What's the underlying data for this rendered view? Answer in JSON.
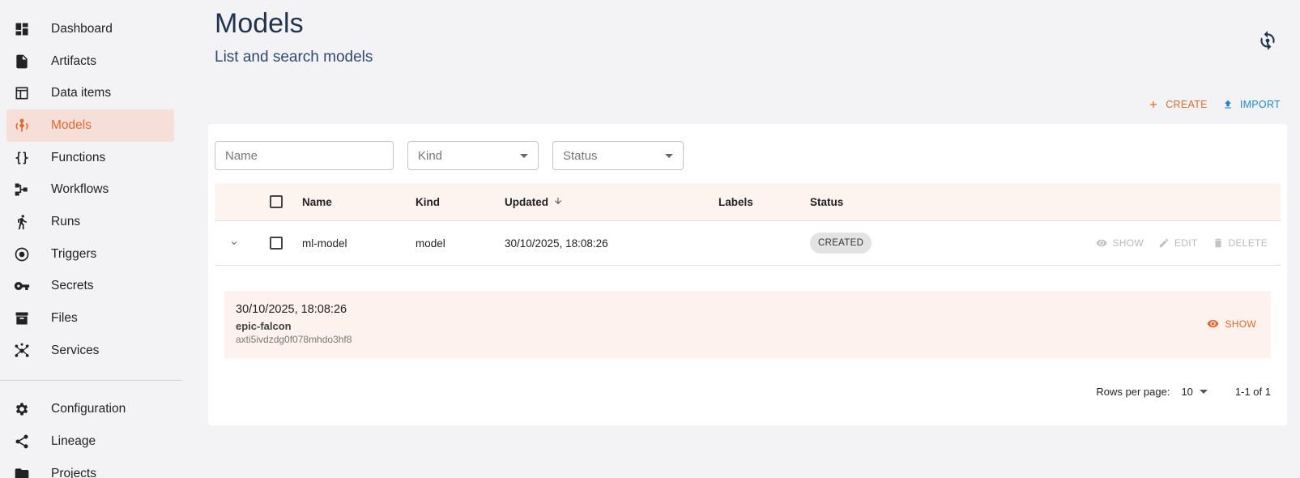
{
  "sidebar": {
    "items": [
      {
        "label": "Dashboard",
        "icon": "dashboard-icon",
        "active": false
      },
      {
        "label": "Artifacts",
        "icon": "file-icon",
        "active": false
      },
      {
        "label": "Data items",
        "icon": "table-icon",
        "active": false
      },
      {
        "label": "Models",
        "icon": "model-icon",
        "active": true
      },
      {
        "label": "Functions",
        "icon": "braces-icon",
        "active": false
      },
      {
        "label": "Workflows",
        "icon": "workflow-icon",
        "active": false
      },
      {
        "label": "Runs",
        "icon": "runner-icon",
        "active": false
      },
      {
        "label": "Triggers",
        "icon": "target-icon",
        "active": false
      },
      {
        "label": "Secrets",
        "icon": "key-icon",
        "active": false
      },
      {
        "label": "Files",
        "icon": "archive-icon",
        "active": false
      },
      {
        "label": "Services",
        "icon": "hub-icon",
        "active": false
      }
    ],
    "secondary_items": [
      {
        "label": "Configuration",
        "icon": "gear-icon"
      },
      {
        "label": "Lineage",
        "icon": "share-icon"
      },
      {
        "label": "Projects",
        "icon": "folder-icon"
      }
    ]
  },
  "header": {
    "title": "Models",
    "subtitle": "List and search models"
  },
  "actions": {
    "create_label": "CREATE",
    "import_label": "IMPORT"
  },
  "filters": {
    "name_placeholder": "Name",
    "kind_placeholder": "Kind",
    "status_placeholder": "Status"
  },
  "table": {
    "columns": {
      "name": "Name",
      "kind": "Kind",
      "updated": "Updated",
      "labels": "Labels",
      "status": "Status"
    },
    "rows": [
      {
        "name": "ml-model",
        "kind": "model",
        "updated": "30/10/2025, 18:08:26",
        "labels": "",
        "status": "CREATED",
        "show_label": "SHOW",
        "edit_label": "EDIT",
        "delete_label": "DELETE"
      }
    ]
  },
  "detail": {
    "date": "30/10/2025, 18:08:26",
    "name": "epic-falcon",
    "id": "axti5ivdzdg0f078mhdo3hf8",
    "show_label": "SHOW"
  },
  "pagination": {
    "rows_per_page_label": "Rows per page:",
    "rows_per_page_value": "10",
    "range": "1-1 of 1"
  },
  "colors": {
    "accent": "#e0692f",
    "link": "#1d86c8",
    "title": "#1f3350"
  }
}
